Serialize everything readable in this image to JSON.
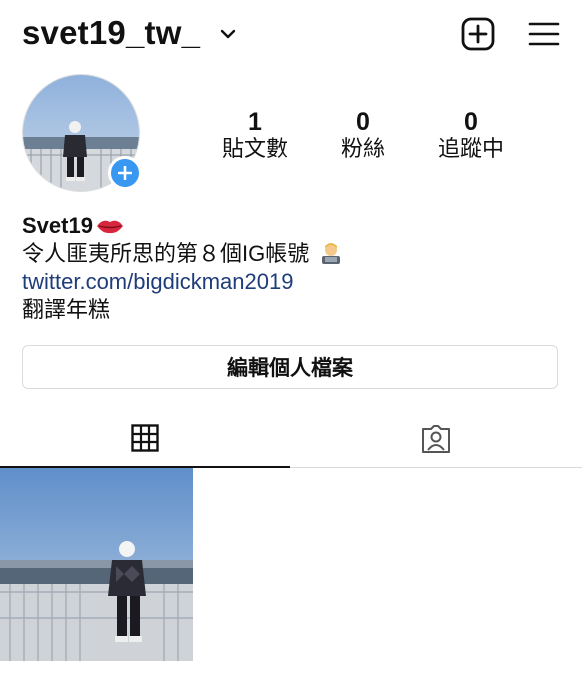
{
  "header": {
    "username": "svet19_tw_"
  },
  "stats": [
    {
      "value": "1",
      "label": "貼文數"
    },
    {
      "value": "0",
      "label": "粉絲"
    },
    {
      "value": "0",
      "label": "追蹤中"
    }
  ],
  "bio": {
    "name": "Svet19",
    "line1": "令人匪夷所思的第８個IG帳號",
    "link": "twitter.com/bigdickman2019",
    "line3": "翻譯年糕"
  },
  "buttons": {
    "edit_profile": "編輯個人檔案"
  },
  "colors": {
    "accent_blue": "#3897f0",
    "link_blue": "#1f3d7a",
    "divider": "#dbdbdb"
  },
  "icons": {
    "dropdown": "chevron-down-icon",
    "new_post": "plus-square-icon",
    "menu": "hamburger-menu-icon",
    "add_story": "plus-icon",
    "grid_tab": "grid-icon",
    "tagged_tab": "tagged-person-icon"
  }
}
